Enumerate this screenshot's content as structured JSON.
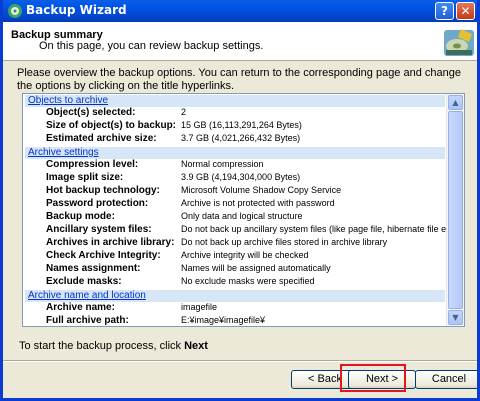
{
  "window": {
    "title": "Backup Wizard"
  },
  "header": {
    "title": "Backup summary",
    "subtitle": "On this page, you can review backup settings."
  },
  "intro": "Please overview the backup options. You can return to the corresponding page and change the options by clicking on the title hyperlinks.",
  "sections": [
    {
      "title": "Objects to archive",
      "rows": [
        {
          "k": "Object(s) selected:",
          "v": "2"
        },
        {
          "k": "Size of object(s) to backup:",
          "v": "15 GB (16,113,291,264 Bytes)"
        },
        {
          "k": "Estimated archive size:",
          "v": "3.7 GB (4,021,266,432 Bytes)"
        }
      ]
    },
    {
      "title": "Archive settings",
      "rows": [
        {
          "k": "Compression level:",
          "v": "Normal compression"
        },
        {
          "k": "Image split size:",
          "v": "3.9 GB (4,194,304,000 Bytes)"
        },
        {
          "k": "Hot backup technology:",
          "v": "Microsoft Volume Shadow Copy Service"
        },
        {
          "k": "Password protection:",
          "v": "Archive is not protected with password"
        },
        {
          "k": "Backup mode:",
          "v": "Only data and logical structure"
        },
        {
          "k": "Ancillary system files:",
          "v": "Do not back up ancillary system files (like page file, hibernate file etc.)"
        },
        {
          "k": "Archives in archive library:",
          "v": "Do not back up archive files stored in archive library"
        },
        {
          "k": "Check Archive Integrity:",
          "v": "Archive integrity will be checked"
        },
        {
          "k": "Names assignment:",
          "v": "Names will be assigned automatically"
        },
        {
          "k": "Exclude masks:",
          "v": "No exclude masks were specified"
        }
      ]
    },
    {
      "title": "Archive name and location",
      "rows": [
        {
          "k": "Archive name:",
          "v": "imagefile"
        },
        {
          "k": "Full archive path:",
          "v": "E:¥image¥imagefile¥"
        }
      ]
    }
  ],
  "footer": {
    "prefix": "To start the backup process, click",
    "strong": "Next"
  },
  "buttons": {
    "back": "< Back",
    "next": "Next >",
    "cancel": "Cancel"
  },
  "icons": {
    "app": "backup-wizard-icon",
    "header": "backup-disk-icon",
    "help": "help-icon",
    "close": "close-icon"
  },
  "colors": {
    "titlebar": "#0055e5",
    "section_bg": "#d7e6f7",
    "link": "#0033cc",
    "highlight": "#e3161b"
  }
}
